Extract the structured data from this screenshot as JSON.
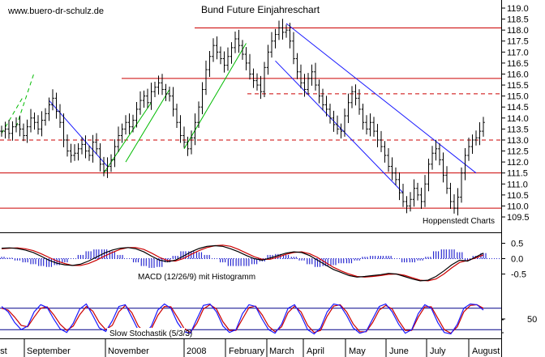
{
  "watermark": "www.buero-dr-schulz.de",
  "credit": "Hoppenstedt Charts",
  "colors": {
    "price": "#000000",
    "hline": "#cc0000",
    "channel_down": "#1a1aff",
    "channel_up": "#00bb00",
    "macd": "#000000",
    "signal": "#cc0000",
    "histogram": "#2a2ad0",
    "stoch_k": "#1a1aff",
    "stoch_d": "#cc0000",
    "band": "#000088"
  },
  "chart_data": [
    {
      "type": "line",
      "title": "Bund Future Einjahreschart",
      "ylim": [
        109.5,
        119.0
      ],
      "y_ticks": [
        "119.0",
        "118.5",
        "118.0",
        "117.5",
        "117.0",
        "116.5",
        "116.0",
        "115.5",
        "115.0",
        "114.5",
        "114.0",
        "113.5",
        "113.0",
        "112.5",
        "112.0",
        "111.5",
        "111.0",
        "110.5",
        "110.0",
        "109.5"
      ],
      "x_tick_labels": [
        "ust",
        "September",
        "November",
        "2008",
        "February",
        "March",
        "April",
        "May",
        "June",
        "July",
        "August"
      ],
      "series": [
        {
          "values": [
            113.4,
            113.5,
            113.3,
            113.6,
            113.7,
            113.5,
            113.2,
            113.6,
            114.0,
            113.8,
            113.5,
            113.9,
            114.2,
            114.6,
            114.9,
            114.3,
            113.8,
            113.0,
            112.5,
            112.3,
            112.4,
            112.6,
            112.8,
            112.5,
            112.3,
            112.9,
            112.6,
            111.9,
            111.6,
            111.8,
            112.1,
            112.7,
            113.2,
            113.5,
            113.8,
            113.6,
            113.9,
            114.4,
            114.8,
            115.0,
            114.7,
            115.2,
            115.4,
            115.6,
            115.3,
            115.1,
            115.0,
            114.4,
            113.8,
            113.2,
            112.9,
            112.6,
            113.1,
            113.8,
            114.5,
            115.3,
            116.2,
            116.8,
            117.3,
            117.0,
            116.7,
            116.4,
            116.8,
            117.2,
            117.6,
            117.3,
            116.9,
            116.5,
            116.0,
            115.7,
            115.5,
            115.2,
            116.3,
            117.0,
            117.5,
            117.8,
            118.1,
            117.9,
            118.0,
            117.5,
            116.7,
            116.1,
            115.6,
            115.3,
            115.8,
            116.1,
            115.5,
            115.0,
            114.6,
            114.4,
            114.0,
            113.7,
            113.5,
            113.4,
            114.1,
            114.7,
            115.2,
            114.9,
            114.4,
            113.8,
            113.5,
            113.8,
            113.4,
            113.0,
            112.7,
            112.3,
            111.8,
            111.5,
            111.2,
            110.6,
            110.2,
            110.0,
            110.3,
            110.8,
            110.5,
            110.2,
            111.0,
            111.9,
            112.4,
            112.6,
            112.1,
            111.4,
            110.8,
            110.2,
            109.9,
            110.4,
            111.5,
            112.3,
            112.7,
            113.0,
            113.1,
            113.4,
            113.8
          ]
        }
      ],
      "horizontal_levels": [
        {
          "value": 118.1,
          "style": "solid"
        },
        {
          "value": 115.8,
          "style": "solid"
        },
        {
          "value": 115.1,
          "style": "dashed"
        },
        {
          "value": 113.0,
          "style": "dashed"
        },
        {
          "value": 111.5,
          "style": "solid"
        },
        {
          "value": 109.9,
          "style": "solid"
        }
      ]
    },
    {
      "type": "line",
      "title": "MACD (12/26/9) mit Histogramm",
      "ylim": [
        -0.75,
        0.75
      ],
      "y_ticks": [
        "0.5",
        "0.0",
        "-0.5"
      ],
      "series": [
        {
          "name": "macd",
          "values": [
            0.34,
            0.35,
            0.33,
            0.28,
            0.2,
            0.08,
            -0.05,
            -0.15,
            -0.2,
            -0.22,
            -0.18,
            -0.08,
            0.05,
            0.18,
            0.28,
            0.34,
            0.36,
            0.32,
            0.22,
            0.08,
            -0.05,
            -0.1,
            -0.05,
            0.08,
            0.22,
            0.33,
            0.4,
            0.42,
            0.4,
            0.32,
            0.22,
            0.1,
            0.0,
            -0.05,
            0.02,
            0.1,
            0.18,
            0.22,
            0.2,
            0.1,
            -0.05,
            -0.2,
            -0.35,
            -0.45,
            -0.55,
            -0.6,
            -0.58,
            -0.55,
            -0.52,
            -0.48,
            -0.5,
            -0.58,
            -0.66,
            -0.72,
            -0.7,
            -0.58,
            -0.4,
            -0.2,
            -0.05,
            -0.08,
            0.05,
            0.18
          ]
        },
        {
          "name": "signal",
          "values": [
            0.32,
            0.34,
            0.35,
            0.32,
            0.26,
            0.16,
            0.04,
            -0.08,
            -0.16,
            -0.22,
            -0.22,
            -0.16,
            -0.05,
            0.08,
            0.2,
            0.3,
            0.36,
            0.36,
            0.3,
            0.18,
            0.04,
            -0.06,
            -0.08,
            0.0,
            0.14,
            0.26,
            0.36,
            0.42,
            0.44,
            0.4,
            0.3,
            0.18,
            0.06,
            -0.02,
            -0.02,
            0.05,
            0.14,
            0.2,
            0.22,
            0.16,
            0.04,
            -0.12,
            -0.28,
            -0.4,
            -0.5,
            -0.58,
            -0.6,
            -0.58,
            -0.55,
            -0.51,
            -0.5,
            -0.54,
            -0.62,
            -0.7,
            -0.72,
            -0.66,
            -0.5,
            -0.3,
            -0.12,
            -0.06,
            0.02,
            0.12
          ]
        }
      ]
    },
    {
      "type": "line",
      "title": "Slow Stochastik (5/3/3)",
      "ylim": [
        0,
        100
      ],
      "y_ticks": [
        "50"
      ],
      "bands": [
        80,
        20
      ],
      "series": [
        {
          "name": "k",
          "values": [
            85,
            70,
            40,
            20,
            30,
            70,
            90,
            82,
            50,
            22,
            12,
            38,
            78,
            92,
            60,
            25,
            15,
            45,
            85,
            90,
            55,
            18,
            8,
            30,
            75,
            92,
            80,
            40,
            14,
            10,
            50,
            88,
            92,
            70,
            30,
            12,
            20,
            65,
            90,
            85,
            50,
            20,
            10,
            35,
            80,
            90,
            60,
            20,
            8,
            25,
            70,
            92,
            88,
            60,
            25,
            10,
            15,
            50,
            85,
            92,
            70,
            35,
            10,
            20,
            65,
            90,
            80,
            40,
            12,
            8,
            35,
            80,
            92,
            90,
            75
          ]
        },
        {
          "name": "d",
          "values": [
            80,
            75,
            55,
            32,
            28,
            55,
            80,
            84,
            62,
            35,
            18,
            30,
            62,
            85,
            72,
            40,
            20,
            32,
            70,
            88,
            68,
            30,
            12,
            22,
            60,
            85,
            84,
            55,
            24,
            12,
            38,
            78,
            90,
            78,
            42,
            18,
            18,
            50,
            82,
            86,
            62,
            30,
            14,
            28,
            68,
            86,
            70,
            32,
            12,
            18,
            58,
            86,
            90,
            70,
            36,
            14,
            14,
            40,
            75,
            88,
            78,
            45,
            18,
            18,
            55,
            84,
            84,
            52,
            20,
            10,
            28,
            70,
            88,
            90,
            80
          ]
        }
      ]
    }
  ]
}
